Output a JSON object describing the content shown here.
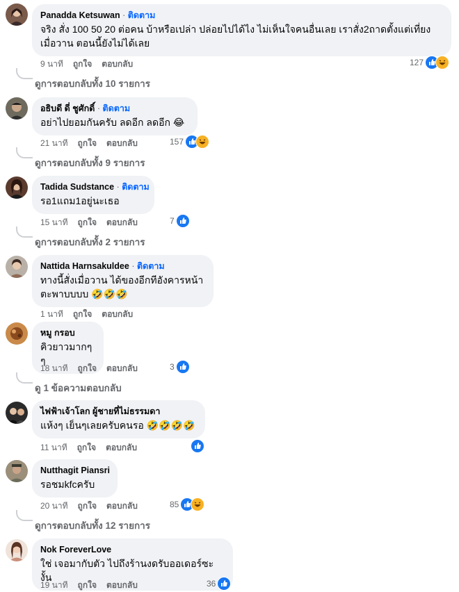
{
  "follow_label": "ติดตาม",
  "separator": "·",
  "like_label": "ถูกใจ",
  "reply_label": "ตอบกลับ",
  "comments": [
    {
      "name": "Panadda Ketsuwan",
      "text": [
        "จริง สั่ง 100 50 20 ต่อคน บ้าหรือเปล่า ปล่อยไปได้ไง ไม่เห็นใจคนอื่นเลย เราสั่ง2ถาดตั้งแต่เที่ยง",
        "เมื่อวาน ตอนนี้ยังไม่ได้เลย"
      ],
      "time": "9 นาที",
      "reactions": "127",
      "reaction_icons": [
        "like-icon",
        "haha-icon"
      ],
      "replies": "ดูการตอบกลับทั้ง 10 รายการ"
    },
    {
      "name": "อธิบดี ดี่ ชูศักดิ์",
      "text": [
        "อย่าไปยอมกันครับ ลดอีก ลดอีก 😂"
      ],
      "time": "21 นาที",
      "reactions": "157",
      "reaction_icons": [
        "like-icon",
        "haha-icon"
      ],
      "replies": "ดูการตอบกลับทั้ง 9 รายการ"
    },
    {
      "name": "Tadida Sudstance",
      "text": [
        "รอ1แถม1อยู่นะเธอ"
      ],
      "time": "15 นาที",
      "reactions": "7",
      "reaction_icons": [
        "like-icon"
      ],
      "replies": "ดูการตอบกลับทั้ง 2 รายการ"
    },
    {
      "name": "Nattida Harnsakuldee",
      "text": [
        "ทางนี้สั่งเมื่อวาน ได้ของอีกทีอังคารหน้า",
        "ตะพาบบบบ 🤣🤣🤣"
      ],
      "time": "1 นาที",
      "reactions": "",
      "reaction_icons": [],
      "replies": ""
    },
    {
      "name": "หมู กรอบ",
      "text": [
        "คิวยาวมากๆๆ"
      ],
      "time": "18 นาที",
      "reactions": "3",
      "reaction_icons": [
        "like-icon"
      ],
      "replies": "ดู 1 ข้อความตอบกลับ"
    },
    {
      "name": "ไฟฟ้าเจ้าโลก ผู้ชายที่ไม่ธรรมดา",
      "text": [
        "แห้งๆ เย็นๆเลยครับคนรอ 🤣🤣🤣🤣"
      ],
      "time": "11 นาที",
      "reactions": "",
      "reaction_icons": [
        "like-icon"
      ],
      "replies": ""
    },
    {
      "name": "Nutthagit Piansri",
      "text": [
        "รอชมkfcครับ"
      ],
      "time": "20 นาที",
      "reactions": "85",
      "reaction_icons": [
        "like-icon",
        "haha-icon"
      ],
      "replies": "ดูการตอบกลับทั้ง 12 รายการ"
    },
    {
      "name": "Nok ForeverLove",
      "text": [
        "ใช่ เจอมากับตัว ไปถึงร้านงดรับออเดอร์ซะงั้น"
      ],
      "time": "19 นาที",
      "reactions": "36",
      "reaction_icons": [
        "like-icon"
      ],
      "replies": ""
    }
  ]
}
